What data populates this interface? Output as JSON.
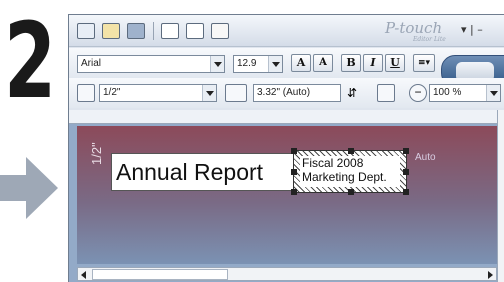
{
  "step": {
    "number": "2"
  },
  "app": {
    "brand": "P-touch",
    "brand_sub": "Editor Lite",
    "window_controls": "▾ | –"
  },
  "toolbar1": {
    "font_name": "Arial",
    "font_size": "12.9"
  },
  "toolbar2": {
    "tape_width": "1/2\"",
    "label_length": "3.32\" (Auto)",
    "zoom": "100 %"
  },
  "format_buttons": [
    "A",
    "A",
    "B",
    "I",
    "U"
  ],
  "canvas": {
    "tape_side_label": "1/2\"",
    "text_object": "Annual Report",
    "selected_text_line1": "Fiscal 2008",
    "selected_text_line2": "Marketing Dept.",
    "auto_label": "Auto"
  },
  "colors": {
    "tape_top": "#8c4a5a",
    "tape_bottom": "#7b92b3",
    "print_button": "#2f5685",
    "arrow": "#9ea8b6"
  },
  "icons": [
    "new-icon",
    "open-icon",
    "save-icon",
    "text-icon",
    "frame-icon",
    "image-icon",
    "print-icon",
    "align-icon",
    "tape-width-icon",
    "length-icon",
    "vertical-text-icon",
    "zoom-out-icon"
  ]
}
